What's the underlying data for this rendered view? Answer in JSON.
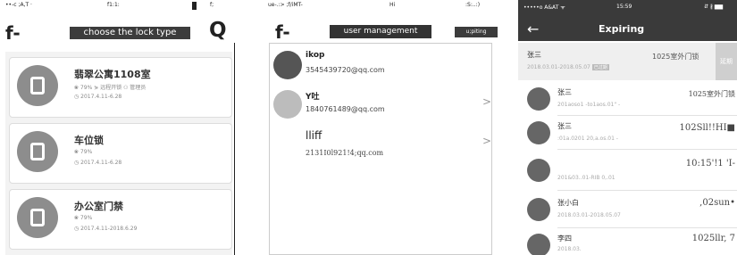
{
  "panel1": {
    "statusbar": {
      "left": "••-c ;A,T ·",
      "center": "f1:1:",
      "right": "f;"
    },
    "nav": {
      "back": "f-",
      "title": "choose the lock type",
      "search": "Q"
    },
    "cards": [
      {
        "title": "翡翠公寓1108室",
        "line1": "❀ 79%  ⋟ 远程开锁  ⚇ 管理员",
        "line2": "◷ 2017.4.11-6.28"
      },
      {
        "title": "车位锁",
        "line1": "❀ 79%",
        "line2": "◷ 2017.4.11-6.28"
      },
      {
        "title": "办公室门禁",
        "line1": "❀ 79%",
        "line2": "◷ 2017.4.11-2018.6.29"
      }
    ]
  },
  "panel2": {
    "statusbar": {
      "left": "ue-.:> ;f/iMT-",
      "center": "Hi",
      "right": ":S:..:)"
    },
    "nav": {
      "back": "f-",
      "title": "user management",
      "right": "u;piting"
    },
    "users": [
      {
        "name": "ikop",
        "email": "3545439720@qq.com"
      },
      {
        "name": "Y吐",
        "email": "1840761489@qq.com"
      },
      {
        "name": "lliff",
        "email": "2131I0l921!4;qq.com"
      }
    ],
    "arrow": ">"
  },
  "panel3": {
    "statusbar": {
      "left": "•••••o A&AT ᯤ",
      "center": "15:59",
      "right": "⇵ ∦ ▆▆"
    },
    "nav": {
      "back": "←",
      "title": "Expiring"
    },
    "header": {
      "name": "张三",
      "dates": "2018.03.01-2018.05.07",
      "tag": "已过期",
      "room": "1025室外门锁",
      "side": "延期"
    },
    "rows": [
      {
        "name": "张三",
        "sub": "201aoso1 -to1aos.01\" -",
        "right": "1025室外门锁"
      },
      {
        "name": "张三",
        "sub": ":01a.0201 20,a.os.01 -",
        "right": "102Sll!!HI■"
      },
      {
        "name": "",
        "sub": "201&03..01-RIB 0,.01",
        "right": "10:15'!1 'I-"
      },
      {
        "name": "张小白",
        "sub": "2018.03.01-2018.05.07",
        "right": ",02sun•"
      },
      {
        "name": "李四",
        "sub": "2018.03.",
        "right": "1025llr, 7"
      }
    ]
  }
}
